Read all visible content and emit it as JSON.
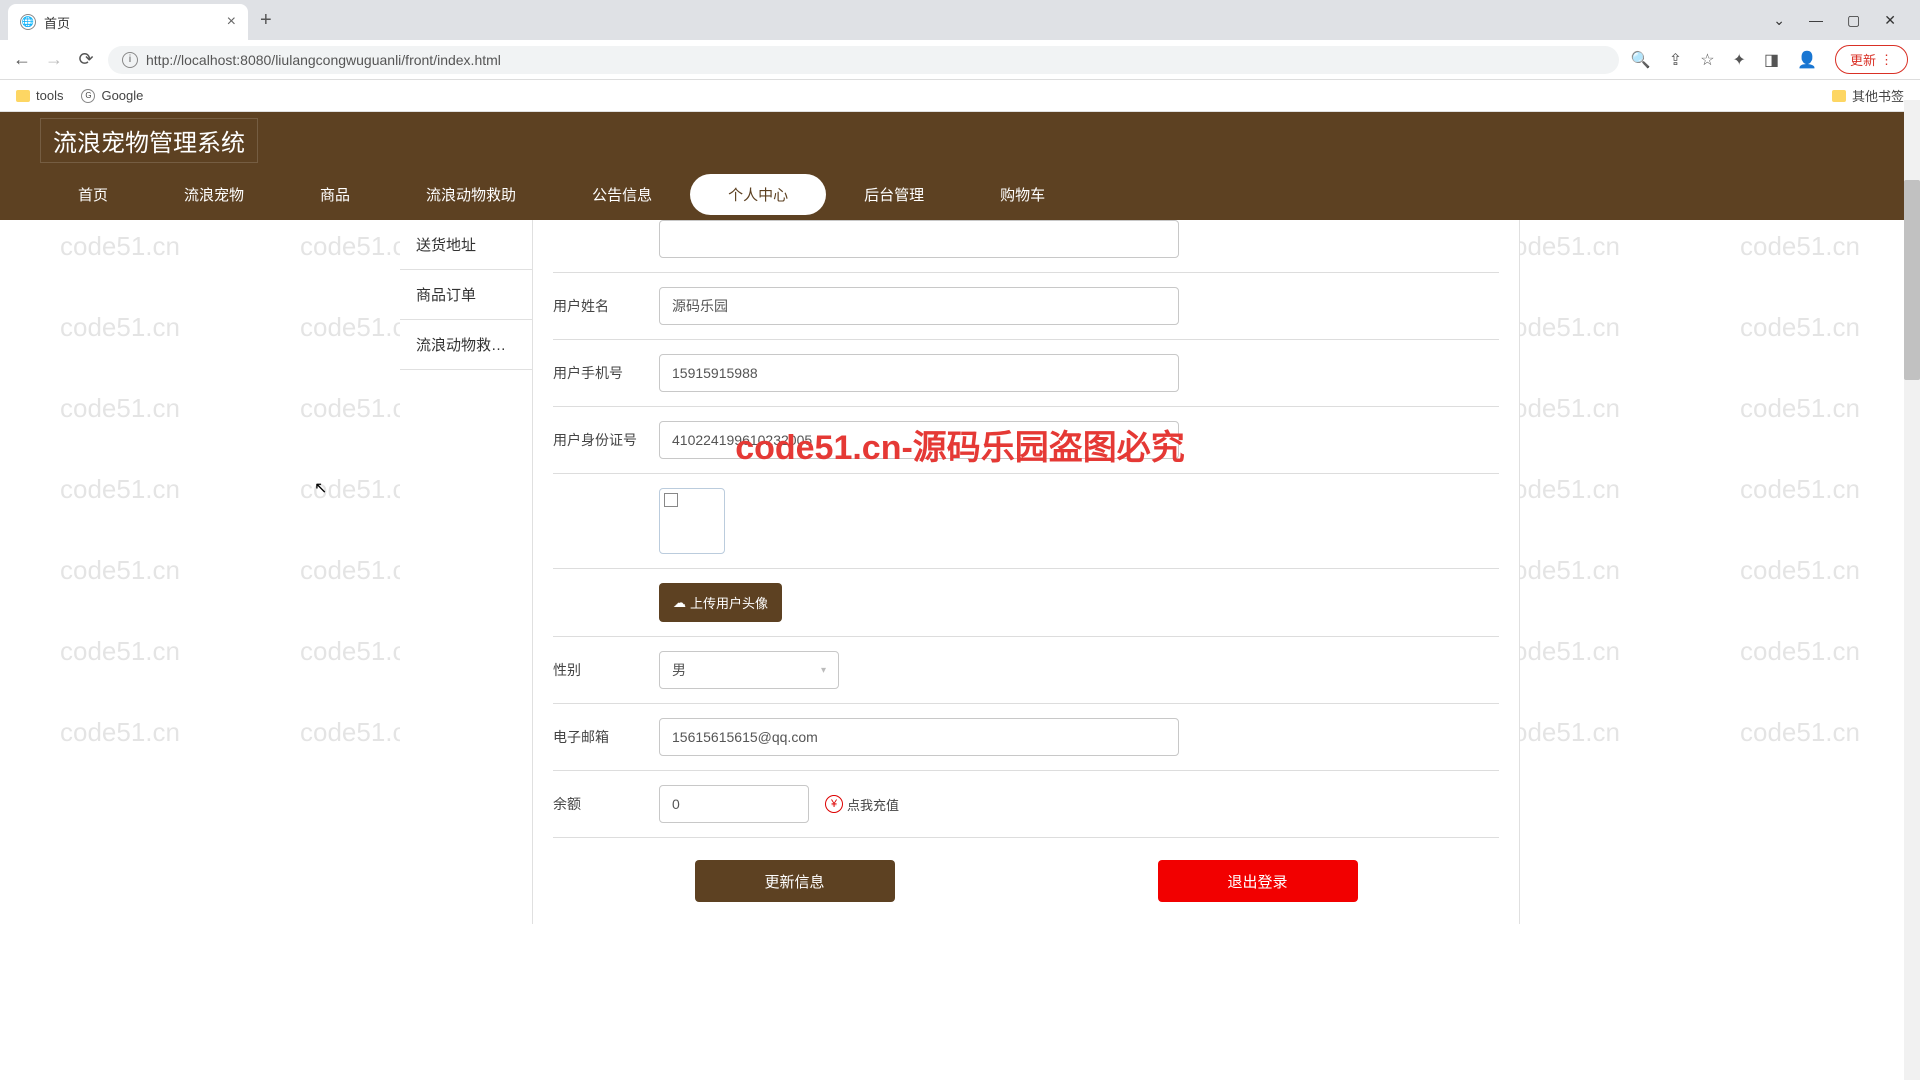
{
  "browser": {
    "tab_title": "首页",
    "url": "http://localhost:8080/liulangcongwuguanli/front/index.html",
    "update_label": "更新",
    "bookmarks": {
      "tools": "tools",
      "google": "Google",
      "other": "其他书签"
    }
  },
  "app": {
    "title": "流浪宠物管理系统",
    "nav": [
      "首页",
      "流浪宠物",
      "商品",
      "流浪动物救助",
      "公告信息",
      "个人中心",
      "后台管理",
      "购物车"
    ],
    "nav_active_index": 5
  },
  "sidebar": {
    "items": [
      "送货地址",
      "商品订单",
      "流浪动物救…"
    ]
  },
  "form": {
    "username_label": "用户姓名",
    "username_value": "源码乐园",
    "phone_label": "用户手机号",
    "phone_value": "15915915988",
    "idcard_label": "用户身份证号",
    "idcard_value": "410224199610232005",
    "upload_label": "上传用户头像",
    "gender_label": "性别",
    "gender_value": "男",
    "email_label": "电子邮箱",
    "email_value": "15615615615@qq.com",
    "balance_label": "余额",
    "balance_value": "0",
    "recharge_label": "点我充值",
    "update_btn": "更新信息",
    "logout_btn": "退出登录"
  },
  "watermark": {
    "text": "code51.cn",
    "center": "code51.cn-源码乐园盗图必究"
  }
}
